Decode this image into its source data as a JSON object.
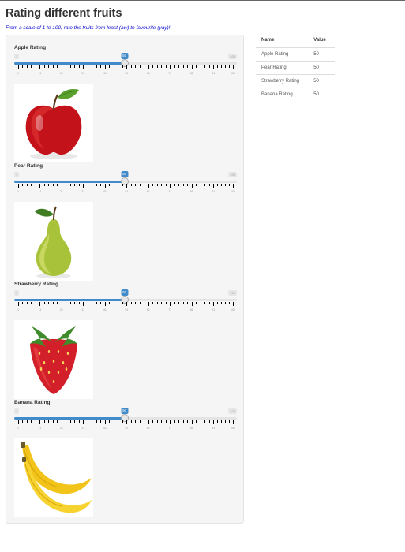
{
  "page": {
    "title": "Rating different fruits",
    "subtitle": "From a scale of 1 to 100, rate the fruits from least (aw) to favourite (yay)!"
  },
  "slider_scale": {
    "min": 1,
    "max": 100,
    "tick_labels": [
      "1",
      "11",
      "21",
      "31",
      "41",
      "51",
      "61",
      "71",
      "81",
      "91",
      "100"
    ]
  },
  "ratings": [
    {
      "label": "Apple Rating",
      "value": 50,
      "image_icon": "apple-image"
    },
    {
      "label": "Pear Rating",
      "value": 50,
      "image_icon": "pear-image"
    },
    {
      "label": "Strawberry Rating",
      "value": 50,
      "image_icon": "strawberry-image"
    },
    {
      "label": "Banana Rating",
      "value": 50,
      "image_icon": "banana-image"
    }
  ],
  "table": {
    "headers": [
      "Name",
      "Value"
    ],
    "rows": [
      [
        "Apple Rating",
        "50"
      ],
      [
        "Pear Rating",
        "50"
      ],
      [
        "Strawberry Rating",
        "50"
      ],
      [
        "Banana Rating",
        "50"
      ]
    ]
  },
  "colors": {
    "accent": "#428bca",
    "subtitle": "#0000cc",
    "panel_bg": "#f5f5f5"
  }
}
